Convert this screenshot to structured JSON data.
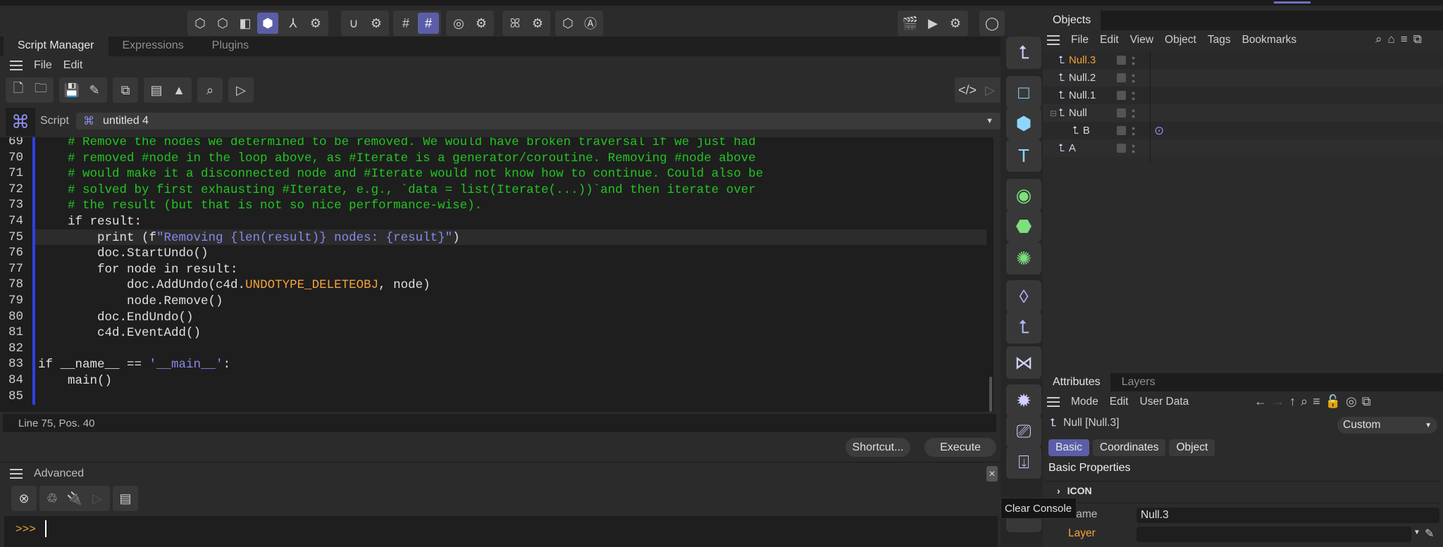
{
  "toolbar": {
    "groups": [
      [
        "⬡",
        "⬡",
        "◧",
        "⬢",
        "◩"
      ],
      [
        "⅄",
        "⚙"
      ],
      [
        "∪",
        "⚙"
      ],
      [
        "#",
        "#"
      ],
      [
        "◎",
        "⚙"
      ],
      [
        "ꕤ",
        "⚙"
      ],
      [
        "⬡",
        "Ⓐ"
      ]
    ],
    "right": [
      "🎬",
      "▶",
      "⚙",
      "◯"
    ],
    "active_indices": [
      [
        0,
        3
      ],
      [
        3,
        1
      ]
    ]
  },
  "script_manager": {
    "tabs": [
      "Script Manager",
      "Expressions",
      "Plugins"
    ],
    "menu": [
      "File",
      "Edit"
    ],
    "script_label": "Script",
    "script_name": "untitled 4",
    "code": [
      {
        "n": "69",
        "t": [
          [
            "c-comment",
            "    # Remove the nodes we determined to be removed. We would have broken traversal if we just had"
          ]
        ]
      },
      {
        "n": "70",
        "t": [
          [
            "c-comment",
            "    # removed #node in the loop above, as #Iterate is a generator/coroutine. Removing #node above"
          ]
        ]
      },
      {
        "n": "71",
        "t": [
          [
            "c-comment",
            "    # would make it a disconnected node and #Iterate would not know how to continue. Could also be"
          ]
        ]
      },
      {
        "n": "72",
        "t": [
          [
            "c-comment",
            "    # solved by first exhausting #Iterate, e.g., `data = list(Iterate(...))`and then iterate over"
          ]
        ]
      },
      {
        "n": "73",
        "t": [
          [
            "c-comment",
            "    # the result (but that is not so nice performance-wise)."
          ]
        ]
      },
      {
        "n": "74",
        "t": [
          [
            "",
            "    if result:"
          ]
        ]
      },
      {
        "n": "75",
        "t": [
          [
            "",
            "        print (f"
          ],
          [
            "c-str",
            "\"Removing {len(result)} nodes: {result}\""
          ],
          [
            "",
            ")"
          ]
        ]
      },
      {
        "n": "76",
        "t": [
          [
            "",
            "        doc.StartUndo()"
          ]
        ]
      },
      {
        "n": "77",
        "t": [
          [
            "",
            "        for node in result:"
          ]
        ]
      },
      {
        "n": "78",
        "t": [
          [
            "",
            "            doc.AddUndo(c4d."
          ],
          [
            "c-const",
            "UNDOTYPE_DELETEOBJ"
          ],
          [
            "",
            ", node)"
          ]
        ]
      },
      {
        "n": "79",
        "t": [
          [
            "",
            "            node.Remove()"
          ]
        ]
      },
      {
        "n": "80",
        "t": [
          [
            "",
            "        doc.EndUndo()"
          ]
        ]
      },
      {
        "n": "81",
        "t": [
          [
            "",
            "        c4d.EventAdd()"
          ]
        ]
      },
      {
        "n": "82",
        "t": [
          [
            "",
            ""
          ]
        ]
      },
      {
        "n": "83",
        "t": [
          [
            "",
            "if __name__ == "
          ],
          [
            "c-str",
            "'__main__'"
          ],
          [
            "",
            ":"
          ]
        ]
      },
      {
        "n": "84",
        "t": [
          [
            "",
            "    main()"
          ]
        ]
      },
      {
        "n": "85",
        "t": [
          [
            "",
            ""
          ]
        ]
      }
    ],
    "status": "Line 75, Pos. 40",
    "shortcut_button": "Shortcut...",
    "execute_button": "Execute"
  },
  "console": {
    "title": "Advanced",
    "prompt": ">>>",
    "tooltip": "Clear Console"
  },
  "objects": {
    "tab": "Objects",
    "menu": [
      "File",
      "Edit",
      "View",
      "Object",
      "Tags",
      "Bookmarks"
    ],
    "items": [
      {
        "name": "Null.3",
        "selected": true,
        "depth": 0
      },
      {
        "name": "Null.2",
        "depth": 0
      },
      {
        "name": "Null.1",
        "depth": 0
      },
      {
        "name": "Null",
        "depth": 0,
        "expanded": true
      },
      {
        "name": "B",
        "depth": 1,
        "tag": "target-tag"
      },
      {
        "name": "A",
        "depth": 0
      }
    ]
  },
  "attributes": {
    "tabs": [
      "Attributes",
      "Layers"
    ],
    "menu": [
      "Mode",
      "Edit",
      "User Data"
    ],
    "object_title": "Null [Null.3]",
    "preset": "Custom",
    "subtabs": [
      "Basic",
      "Coordinates",
      "Object"
    ],
    "section": "Basic Properties",
    "group": "ICON",
    "fields": [
      {
        "label": "Name",
        "value": "Null.3"
      },
      {
        "label": "Layer",
        "value": ""
      }
    ]
  },
  "colors": {
    "accent": "#5b5ea6",
    "selected_text": "#f2a23a",
    "comment": "#22c422"
  }
}
